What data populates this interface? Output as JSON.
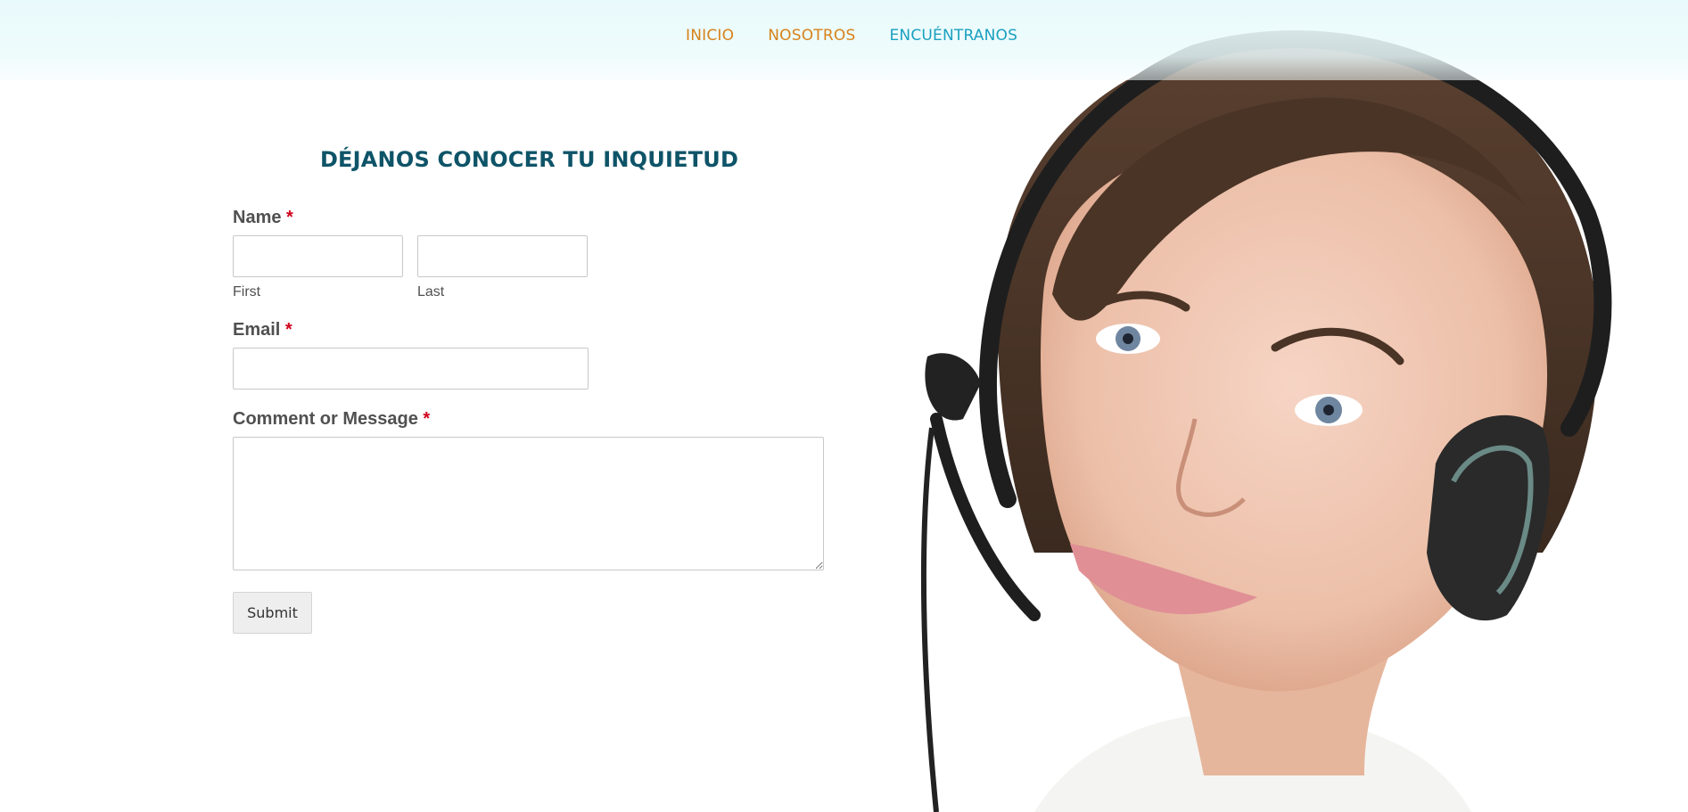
{
  "nav": {
    "items": [
      {
        "label": "INICIO",
        "color": "#d7821a"
      },
      {
        "label": "NOSOTROS",
        "color": "#d7821a"
      },
      {
        "label": "ENCUÉNTRANOS",
        "color": "#1aa0c0"
      }
    ]
  },
  "form": {
    "title": "DÉJANOS CONOCER TU INQUIETUD",
    "name_label": "Name",
    "required_marker": "*",
    "first_sublabel": "First",
    "last_sublabel": "Last",
    "first_value": "",
    "last_value": "",
    "email_label": "Email",
    "email_value": "",
    "message_label": "Comment or Message",
    "message_value": "",
    "submit_label": "Submit"
  },
  "colors": {
    "title": "#0e5468",
    "required": "#d0021b",
    "label_text": "#505050",
    "header_tint": "#e8fafc"
  },
  "photo": {
    "subject": "smiling woman wearing a headset"
  }
}
